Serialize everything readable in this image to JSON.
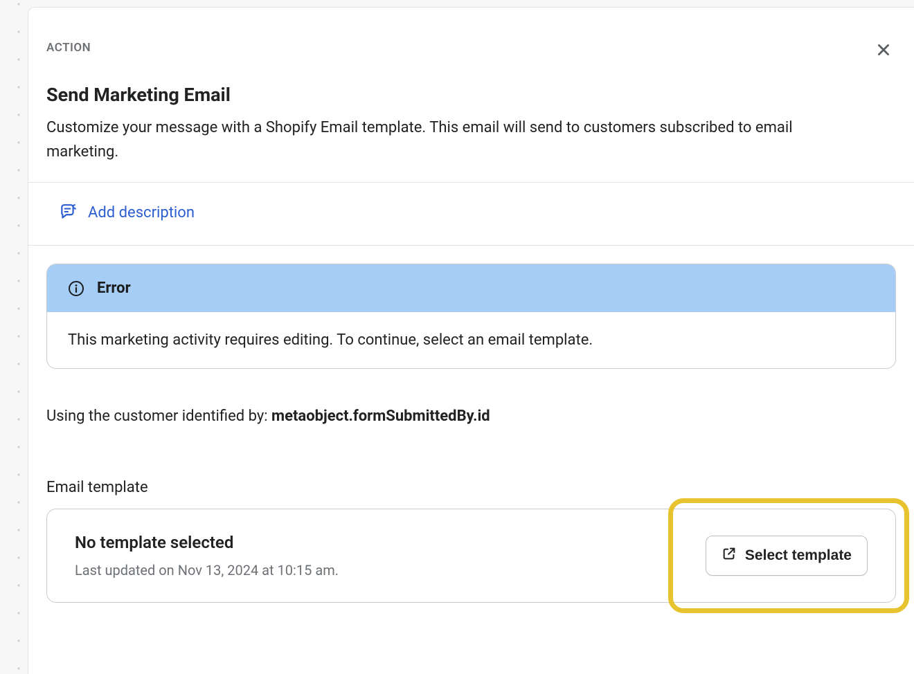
{
  "header": {
    "eyebrow": "ACTION",
    "title": "Send Marketing Email",
    "subtitle": "Customize your message with a Shopify Email template. This email will send to customers subscribed to email marketing."
  },
  "actions": {
    "add_description": "Add description"
  },
  "error": {
    "title": "Error",
    "message": "This marketing activity requires editing. To continue, select an email template."
  },
  "customer": {
    "prefix": "Using the customer identified by: ",
    "identifier": "metaobject.formSubmittedBy.id"
  },
  "email_template": {
    "section_label": "Email template",
    "status": "No template selected",
    "last_updated": "Last updated on Nov 13, 2024 at 10:15 am.",
    "select_button": "Select template"
  }
}
